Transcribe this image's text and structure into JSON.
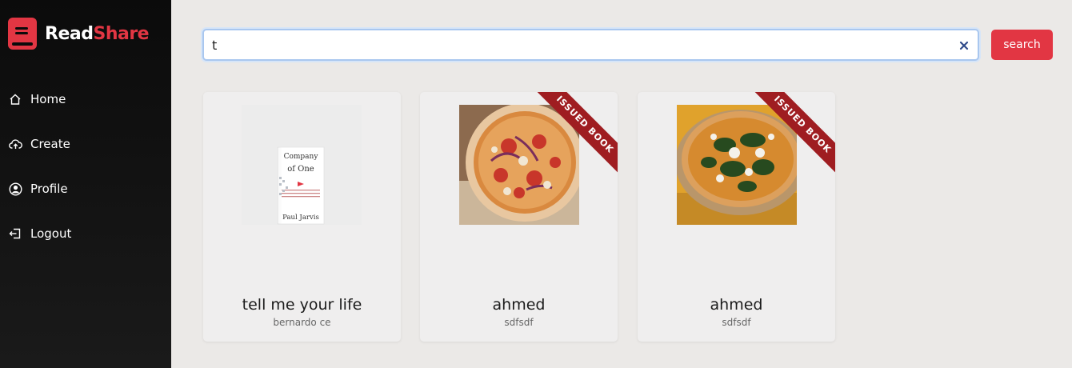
{
  "app": {
    "name_part1": "Read",
    "name_part2": "Share",
    "accent": "#e23643"
  },
  "sidebar": {
    "items": [
      {
        "label": "Home",
        "icon": "home-icon"
      },
      {
        "label": "Create",
        "icon": "cloud-upload-icon"
      },
      {
        "label": "Profile",
        "icon": "user-circle-icon"
      },
      {
        "label": "Logout",
        "icon": "logout-icon"
      }
    ]
  },
  "search": {
    "value": "t",
    "button_label": "search"
  },
  "books": [
    {
      "title": "tell me your life",
      "author": "bernardo ce",
      "issued": false
    },
    {
      "title": "ahmed",
      "author": "sdfsdf",
      "issued": true,
      "badge": "ISSUED BOOK"
    },
    {
      "title": "ahmed",
      "author": "sdfsdf",
      "issued": true,
      "badge": "ISSUED BOOK"
    }
  ]
}
